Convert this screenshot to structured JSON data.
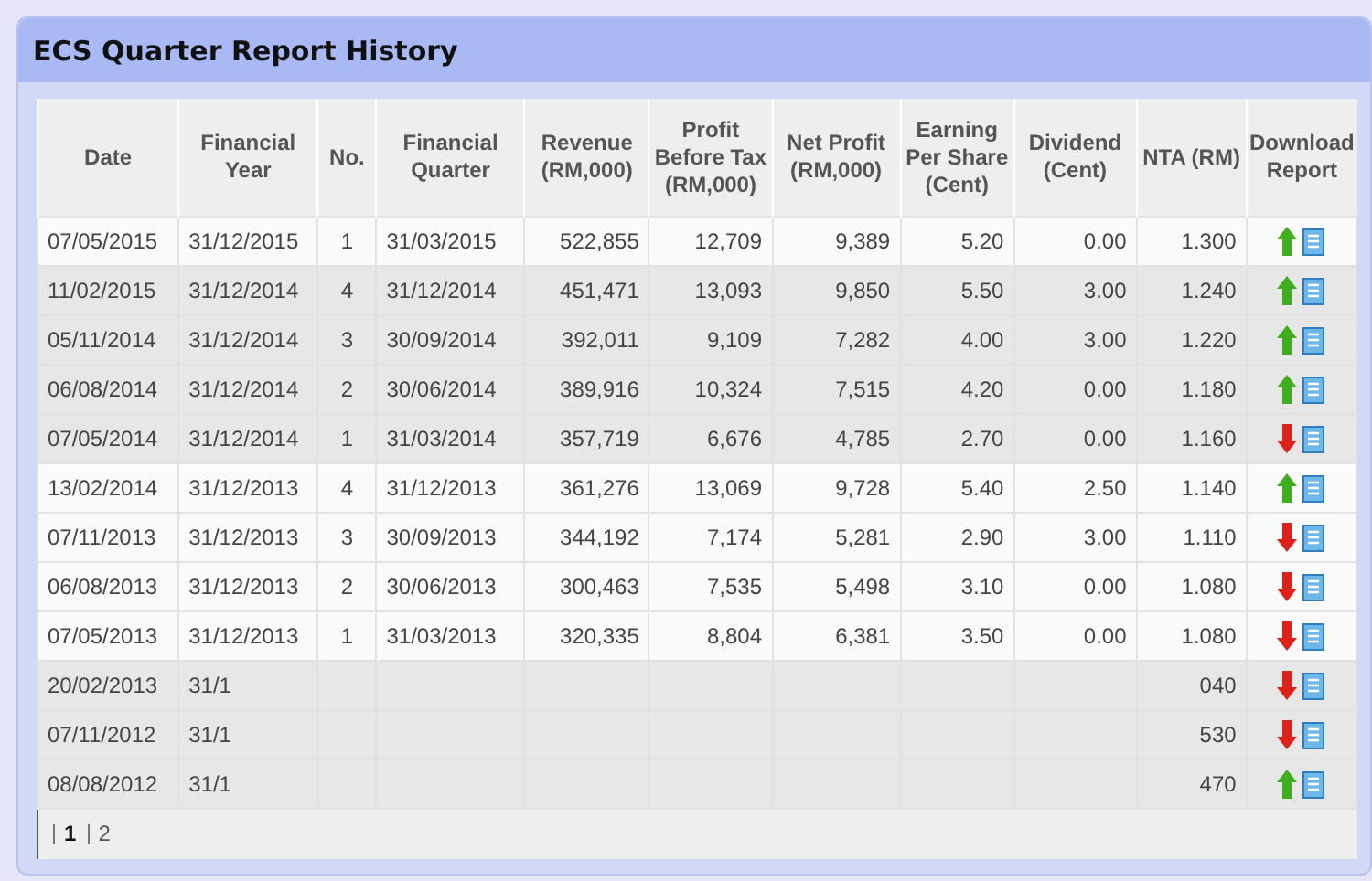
{
  "panel": {
    "title": "ECS Quarter Report History"
  },
  "table": {
    "columns": [
      "Date",
      "Financial Year",
      "No.",
      "Financial Quarter",
      "Revenue (RM,000)",
      "Profit Before Tax (RM,000)",
      "Net Profit (RM,000)",
      "Earning Per Share (Cent)",
      "Dividend (Cent)",
      "NTA (RM)",
      "Download Report"
    ],
    "rows": [
      {
        "shaded": false,
        "rising": true,
        "cells": [
          "07/05/2015",
          "31/12/2015",
          "1",
          "31/03/2015",
          "522,855",
          "12,709",
          "9,389",
          "5.20",
          "0.00",
          "1.300"
        ]
      },
      {
        "shaded": true,
        "rising": true,
        "cells": [
          "11/02/2015",
          "31/12/2014",
          "4",
          "31/12/2014",
          "451,471",
          "13,093",
          "9,850",
          "5.50",
          "3.00",
          "1.240"
        ]
      },
      {
        "shaded": true,
        "rising": true,
        "cells": [
          "05/11/2014",
          "31/12/2014",
          "3",
          "30/09/2014",
          "392,011",
          "9,109",
          "7,282",
          "4.00",
          "3.00",
          "1.220"
        ]
      },
      {
        "shaded": true,
        "rising": true,
        "cells": [
          "06/08/2014",
          "31/12/2014",
          "2",
          "30/06/2014",
          "389,916",
          "10,324",
          "7,515",
          "4.20",
          "0.00",
          "1.180"
        ]
      },
      {
        "shaded": true,
        "rising": false,
        "cells": [
          "07/05/2014",
          "31/12/2014",
          "1",
          "31/03/2014",
          "357,719",
          "6,676",
          "4,785",
          "2.70",
          "0.00",
          "1.160"
        ]
      },
      {
        "shaded": false,
        "rising": true,
        "cells": [
          "13/02/2014",
          "31/12/2013",
          "4",
          "31/12/2013",
          "361,276",
          "13,069",
          "9,728",
          "5.40",
          "2.50",
          "1.140"
        ]
      },
      {
        "shaded": false,
        "rising": false,
        "cells": [
          "07/11/2013",
          "31/12/2013",
          "3",
          "30/09/2013",
          "344,192",
          "7,174",
          "5,281",
          "2.90",
          "3.00",
          "1.110"
        ]
      },
      {
        "shaded": false,
        "rising": false,
        "cells": [
          "06/08/2013",
          "31/12/2013",
          "2",
          "30/06/2013",
          "300,463",
          "7,535",
          "5,498",
          "3.10",
          "0.00",
          "1.080"
        ]
      },
      {
        "shaded": false,
        "rising": false,
        "cells": [
          "07/05/2013",
          "31/12/2013",
          "1",
          "31/03/2013",
          "320,335",
          "8,804",
          "6,381",
          "3.50",
          "0.00",
          "1.080"
        ]
      },
      {
        "shaded": true,
        "rising": false,
        "cells": [
          "20/02/2013",
          "31/1",
          null,
          null,
          null,
          null,
          null,
          null,
          null,
          "040"
        ]
      },
      {
        "shaded": true,
        "rising": false,
        "cells": [
          "07/11/2012",
          "31/1",
          null,
          null,
          null,
          null,
          null,
          null,
          null,
          "530"
        ]
      },
      {
        "shaded": true,
        "rising": true,
        "cells": [
          "08/08/2012",
          "31/1",
          null,
          null,
          null,
          null,
          null,
          null,
          null,
          "470"
        ]
      }
    ]
  },
  "pager": [
    {
      "label": "1",
      "selected": true
    },
    {
      "label": "2",
      "selected": false
    }
  ]
}
